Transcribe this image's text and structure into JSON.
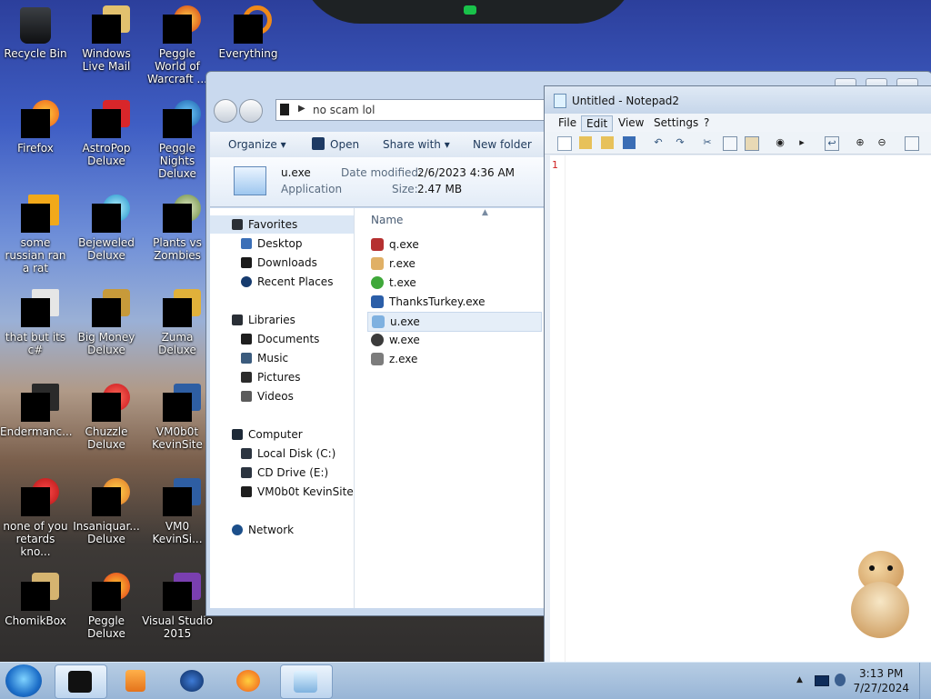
{
  "desktop": {
    "icons": [
      {
        "label": "Recycle Bin"
      },
      {
        "label": "Windows Live Mail"
      },
      {
        "label": "Peggle World of Warcraft ..."
      },
      {
        "label": "Everything"
      },
      {
        "label": "Firefox"
      },
      {
        "label": "AstroPop Deluxe"
      },
      {
        "label": "Peggle Nights Deluxe"
      },
      {
        "label": "some russian ran a rat"
      },
      {
        "label": "Bejeweled Deluxe"
      },
      {
        "label": "Plants vs Zombies"
      },
      {
        "label": "that but its c#"
      },
      {
        "label": "Big Money Deluxe"
      },
      {
        "label": "Zuma Deluxe"
      },
      {
        "label": "Endermanc..."
      },
      {
        "label": "Chuzzle Deluxe"
      },
      {
        "label": "VM0b0t KevinSite"
      },
      {
        "label": "none of you retards kno..."
      },
      {
        "label": "Insaniquar... Deluxe"
      },
      {
        "label": "VM0 KevinSi..."
      },
      {
        "label": "ChomikBox"
      },
      {
        "label": "Peggle Deluxe"
      },
      {
        "label": "Visual Studio 2015"
      }
    ]
  },
  "explorer": {
    "address": "no scam lol",
    "commands": {
      "organize": "Organize",
      "open": "Open",
      "share_with": "Share with",
      "new_folder": "New folder"
    },
    "details": {
      "name": "u.exe",
      "type": "Application",
      "date_label": "Date modified:",
      "date_value": "2/6/2023 4:36 AM",
      "size_label": "Size:",
      "size_value": "2.47 MB"
    },
    "nav": {
      "favorites": "Favorites",
      "desktop": "Desktop",
      "downloads": "Downloads",
      "recent": "Recent Places",
      "libraries": "Libraries",
      "documents": "Documents",
      "music": "Music",
      "pictures": "Pictures",
      "videos": "Videos",
      "computer": "Computer",
      "local_disk": "Local Disk (C:)",
      "cd_drive": "CD Drive (E:)",
      "vm": "VM0b0t KevinSite",
      "network": "Network"
    },
    "files": {
      "header": "Name",
      "items": [
        "q.exe",
        "r.exe",
        "t.exe",
        "ThanksTurkey.exe",
        "u.exe",
        "w.exe",
        "z.exe"
      ]
    }
  },
  "notepad": {
    "title": "Untitled - Notepad2",
    "menu": {
      "file": "File",
      "edit": "Edit",
      "view": "View",
      "settings": "Settings",
      "help": "?"
    },
    "line_number": "1"
  },
  "taskbar": {
    "time": "3:13 PM",
    "date": "7/27/2024"
  }
}
